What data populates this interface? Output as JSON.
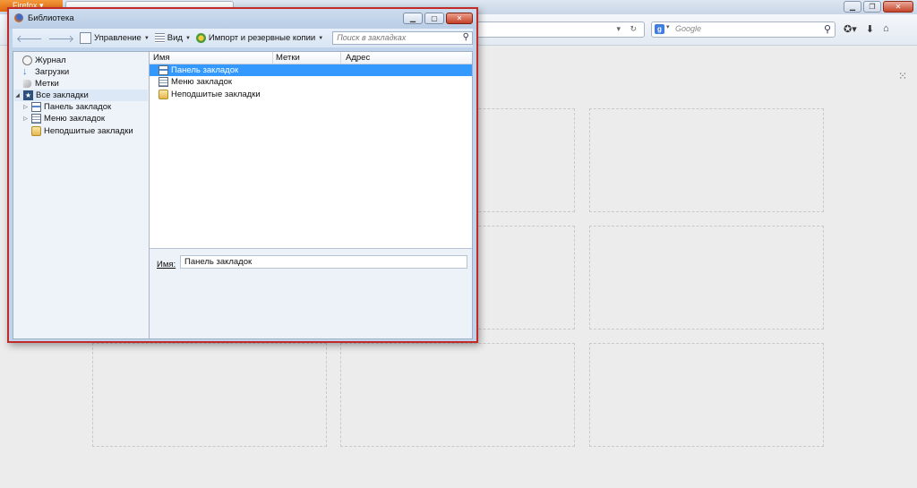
{
  "browser": {
    "app_button_label": "Firefox",
    "tab_title": "",
    "search_placeholder": "Google"
  },
  "library": {
    "title": "Библиотека",
    "toolbar": {
      "manage_label": "Управление",
      "view_label": "Вид",
      "import_label": "Импорт и резервные копии",
      "search_placeholder": "Поиск в закладках"
    },
    "tree": [
      {
        "label": "Журнал",
        "icon": "clock-icon"
      },
      {
        "label": "Загрузки",
        "icon": "download-icon"
      },
      {
        "label": "Метки",
        "icon": "tag-icon"
      },
      {
        "label": "Все закладки",
        "icon": "star-icon"
      },
      {
        "label": "Панель закладок",
        "icon": "bookmarks-toolbar-icon"
      },
      {
        "label": "Меню закладок",
        "icon": "bookmarks-menu-icon"
      },
      {
        "label": "Неподшитые закладки",
        "icon": "unsorted-bookmarks-icon"
      }
    ],
    "columns": [
      "Имя",
      "Метки",
      "Адрес"
    ],
    "rows": [
      {
        "name": "Панель закладок",
        "icon": "bookmarks-toolbar-icon",
        "selected": true
      },
      {
        "name": "Меню закладок",
        "icon": "bookmarks-menu-icon",
        "selected": false
      },
      {
        "name": "Неподшитые закладки",
        "icon": "unsorted-bookmarks-icon",
        "selected": false
      }
    ],
    "details": {
      "name_label": "Имя:",
      "name_value": "Панель закладок"
    }
  },
  "colors": {
    "selection": "#3399ff",
    "dialog_border": "#c22a2a",
    "firefox_orange": "#e2660d"
  }
}
